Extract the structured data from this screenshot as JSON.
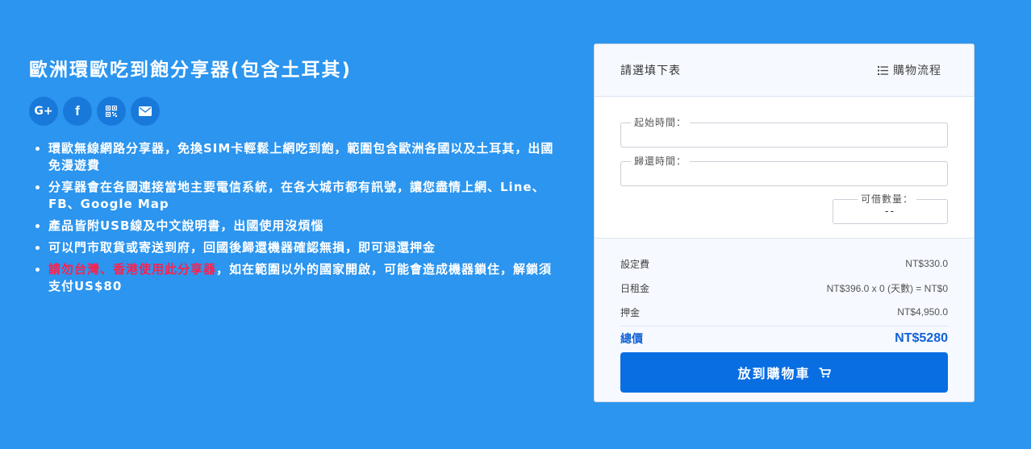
{
  "product": {
    "title": "歐洲環歐吃到飽分享器(包含土耳其)"
  },
  "social": [
    {
      "icon": "google-plus-icon",
      "label": "G+"
    },
    {
      "icon": "facebook-icon",
      "label": "f"
    },
    {
      "icon": "qrcode-icon",
      "label": ""
    },
    {
      "icon": "email-icon",
      "label": ""
    }
  ],
  "features": [
    {
      "text": "環歐無線網路分享器，免換SIM卡輕鬆上網吃到飽，範圍包含歐洲各國以及土耳其，出國免漫遊費"
    },
    {
      "text": "分享器會在各國連接當地主要電信系統，在各大城市都有訊號，讓您盡情上網、Line、FB、Google Map"
    },
    {
      "text": "產品皆附USB線及中文說明書，出國使用沒煩惱"
    },
    {
      "text": "可以門市取貨或寄送到府，回國後歸還機器確認無損，即可退還押金"
    },
    {
      "red": "請勿台灣、香港使用此分享器",
      "text": "，如在範圍以外的國家開啟，可能會造成機器鎖住，解鎖須支付US$80"
    }
  ],
  "card": {
    "header": "請選填下表",
    "flow_label": "購物流程",
    "start_label": "起始時間：",
    "return_label": "歸還時間：",
    "qty_label": "可借數量：",
    "qty_value": "--",
    "setup_label": "設定費",
    "setup_value": "NT$330.0",
    "daily_label": "日租金",
    "daily_value": "NT$396.0 x 0 (天數) = NT$0",
    "deposit_label": "押金",
    "deposit_value": "NT$4,950.0",
    "total_label": "總價",
    "total_value": "NT$5280",
    "button_label": "放到購物車"
  },
  "colors": {
    "background": "#2b95ef",
    "social_button": "#1979db",
    "warning": "#ff1f4b",
    "primary": "#0a6ee3",
    "total": "#1262d8"
  }
}
